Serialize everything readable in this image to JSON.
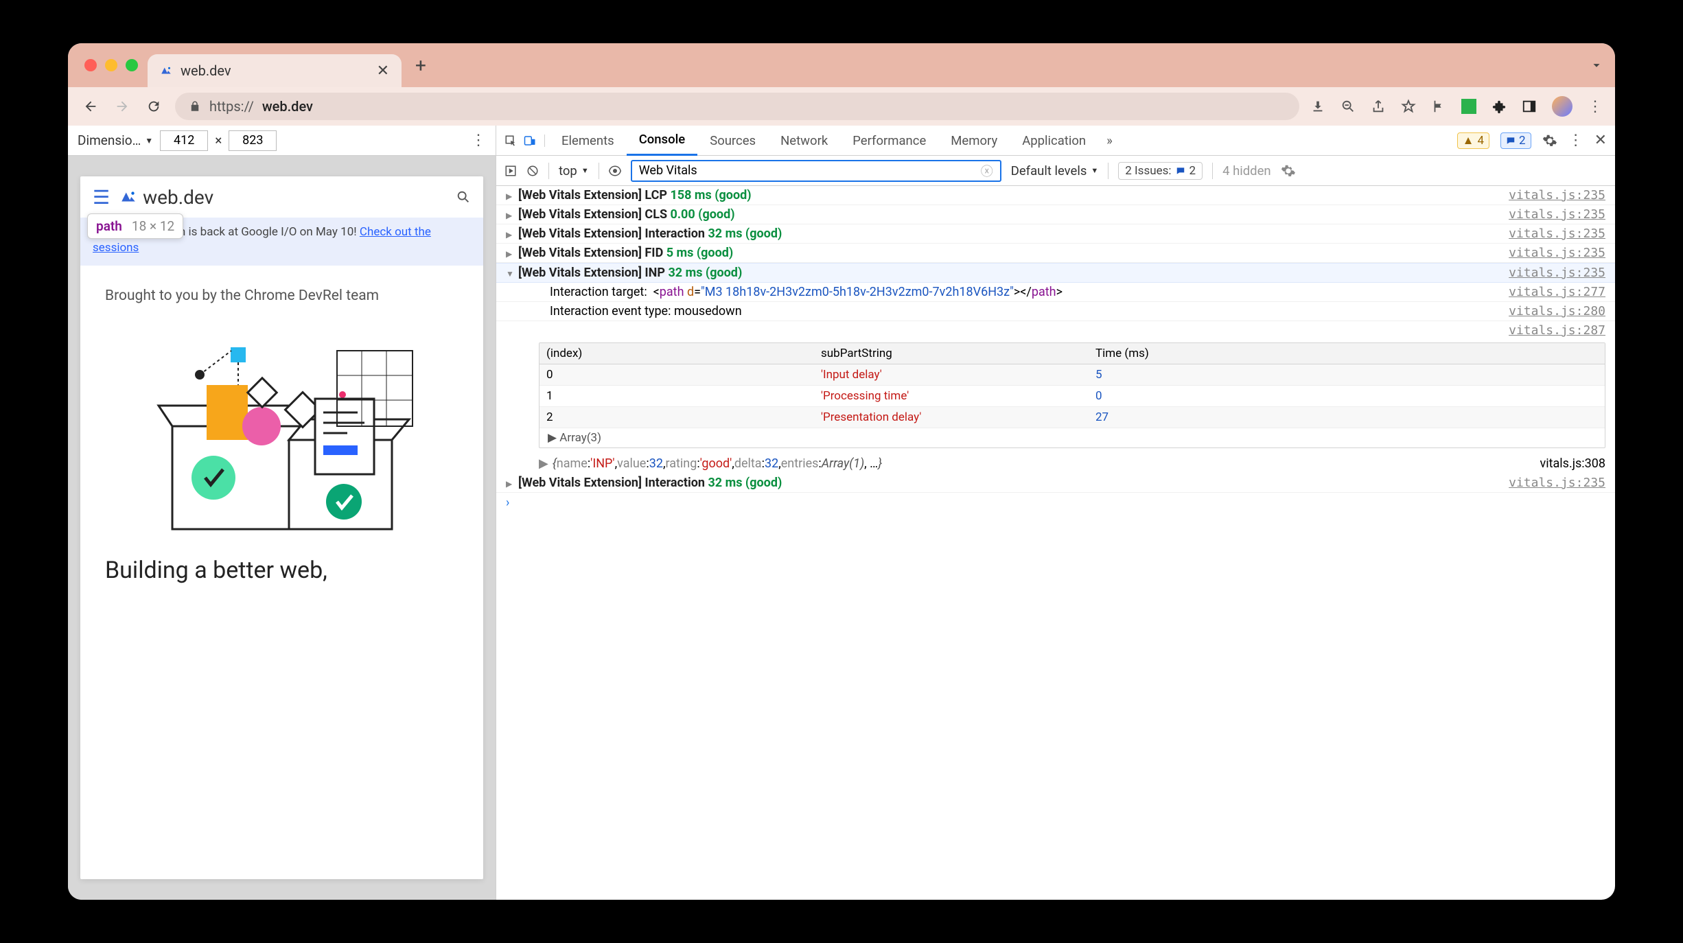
{
  "browser": {
    "tab_title": "web.dev",
    "url_scheme": "https://",
    "url_host": "web.dev"
  },
  "dimensions": {
    "label": "Dimensio…",
    "width": "412",
    "times": "×",
    "height": "823"
  },
  "element_tooltip": {
    "tag": "path",
    "size": "18 × 12"
  },
  "page": {
    "site_title": "web.dev",
    "banner_text": "The Chrome team is back at Google I/O on May 10! ",
    "banner_link": "Check out the sessions",
    "devrel": "Brought to you by the Chrome DevRel team",
    "slogan": "Building a better web,"
  },
  "devtools": {
    "tabs": [
      "Elements",
      "Console",
      "Sources",
      "Network",
      "Performance",
      "Memory",
      "Application"
    ],
    "active_tab": "Console",
    "warn_count": "4",
    "info_count": "2",
    "context": "top",
    "filter_value": "Web Vitals",
    "levels": "Default levels",
    "issues_label": "2 Issues:",
    "issues_count": "2",
    "hidden": "4 hidden"
  },
  "logs": [
    {
      "prefix": "[Web Vitals Extension]",
      "metric": "LCP",
      "value": "158 ms (good)",
      "src": "vitals.js:235",
      "open": false
    },
    {
      "prefix": "[Web Vitals Extension]",
      "metric": "CLS",
      "value": "0.00 (good)",
      "src": "vitals.js:235",
      "open": false
    },
    {
      "prefix": "[Web Vitals Extension]",
      "metric": "Interaction",
      "value": "32 ms (good)",
      "src": "vitals.js:235",
      "open": false
    },
    {
      "prefix": "[Web Vitals Extension]",
      "metric": "FID",
      "value": "5 ms (good)",
      "src": "vitals.js:235",
      "open": false
    },
    {
      "prefix": "[Web Vitals Extension]",
      "metric": "INP",
      "value": "32 ms (good)",
      "src": "vitals.js:235",
      "open": true
    }
  ],
  "detail": {
    "target_label": "Interaction target:",
    "target_tag": "path",
    "target_attr": "d",
    "target_val": "\"M3 18h18v-2H3v2zm0-5h18v-2H3v2zm0-7v2h18V6H3z\"",
    "target_src": "vitals.js:277",
    "event_label": "Interaction event type: ",
    "event_value": "mousedown",
    "event_src": "vitals.js:280",
    "table_src": "vitals.js:287",
    "headers": [
      "(index)",
      "subPartString",
      "Time (ms)"
    ],
    "rows": [
      {
        "i": "0",
        "s": "'Input delay'",
        "t": "5"
      },
      {
        "i": "1",
        "s": "'Processing time'",
        "t": "0"
      },
      {
        "i": "2",
        "s": "'Presentation delay'",
        "t": "27"
      }
    ],
    "array_label": "Array(3)",
    "obj_text": "{name: 'INP', value: 32, rating: 'good', delta: 32, entries: Array(1), …}",
    "obj_src": "vitals.js:308"
  },
  "log_after": {
    "prefix": "[Web Vitals Extension]",
    "metric": "Interaction",
    "value": "32 ms (good)",
    "src": "vitals.js:235"
  }
}
